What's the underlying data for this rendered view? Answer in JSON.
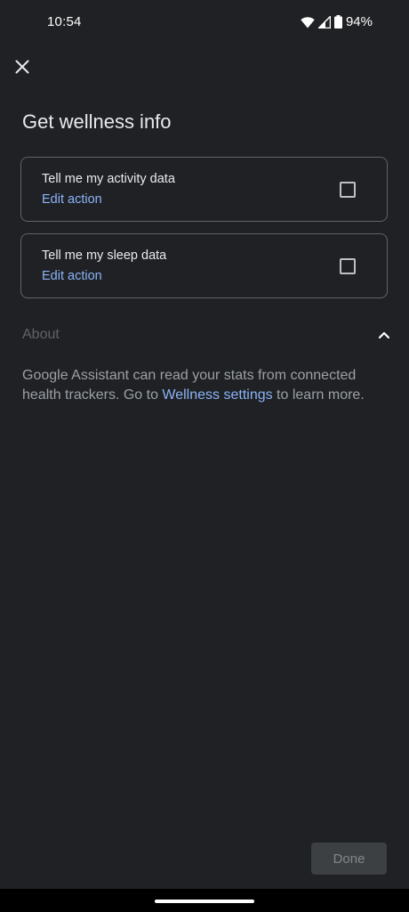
{
  "status_bar": {
    "time": "10:54",
    "battery": "94%",
    "icons": [
      "wifi-icon",
      "cell-signal-icon",
      "battery-icon"
    ]
  },
  "header": {
    "close_icon": "close-icon",
    "title": "Get wellness info"
  },
  "actions": [
    {
      "title": "Tell me my activity data",
      "edit_label": "Edit action",
      "checked": false
    },
    {
      "title": "Tell me my sleep data",
      "edit_label": "Edit action",
      "checked": false
    }
  ],
  "about": {
    "label": "About",
    "expanded": true,
    "text_before": "Google Assistant can read your stats from connected health trackers. Go to ",
    "link_text": "Wellness settings",
    "text_after": " to learn more."
  },
  "footer": {
    "done_label": "Done"
  },
  "colors": {
    "background": "#202124",
    "link": "#8ab4f8",
    "card_border": "#5f6368",
    "button_bg": "#3c4043"
  }
}
